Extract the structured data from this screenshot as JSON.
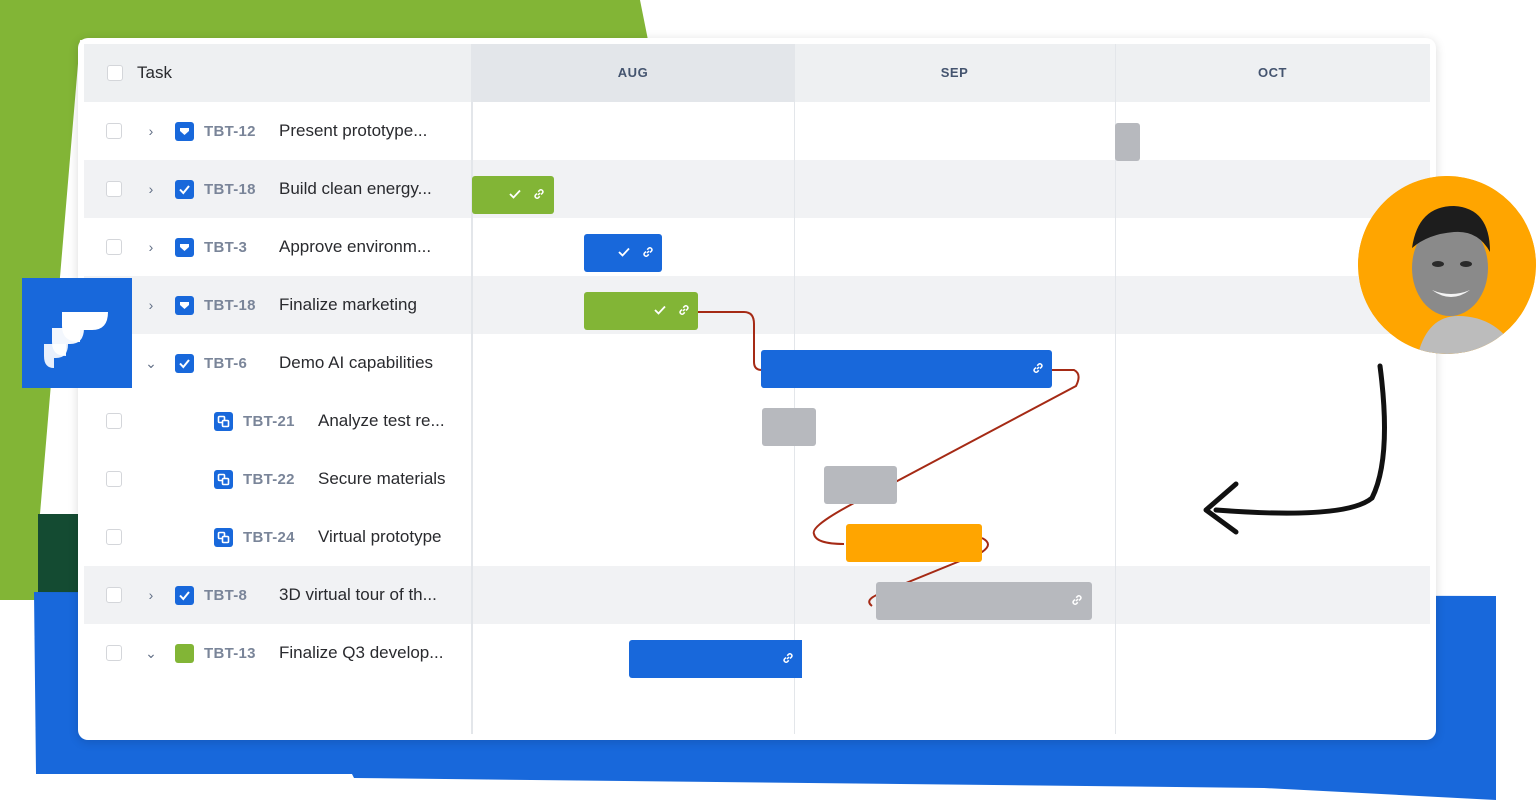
{
  "colors": {
    "blue": "#1868db",
    "green": "#82b536",
    "gray": "#b7b9be",
    "orange": "#ffa500",
    "dependency_line": "#a52a15"
  },
  "header": {
    "task_label": "Task",
    "months": [
      "AUG",
      "SEP",
      "OCT"
    ]
  },
  "rows": [
    {
      "key": "TBT-12",
      "title": "Present prototype...",
      "type": "epic",
      "expand": "collapsed"
    },
    {
      "key": "TBT-18",
      "title": "Build clean energy...",
      "type": "task",
      "expand": "collapsed"
    },
    {
      "key": "TBT-3",
      "title": "Approve environm...",
      "type": "epic",
      "expand": "collapsed"
    },
    {
      "key": "TBT-18",
      "title": "Finalize marketing",
      "type": "epic",
      "expand": "collapsed"
    },
    {
      "key": "TBT-6",
      "title": "Demo AI capabilities",
      "type": "task",
      "expand": "expanded"
    },
    {
      "key": "TBT-21",
      "title": "Analyze test re...",
      "type": "subtask",
      "expand": "none"
    },
    {
      "key": "TBT-22",
      "title": "Secure materials",
      "type": "subtask",
      "expand": "none"
    },
    {
      "key": "TBT-24",
      "title": "Virtual prototype",
      "type": "subtask",
      "expand": "none"
    },
    {
      "key": "TBT-8",
      "title": "3D virtual tour of th...",
      "type": "task",
      "expand": "collapsed"
    },
    {
      "key": "TBT-13",
      "title": "Finalize Q3 develop...",
      "type": "story",
      "expand": "expanded"
    }
  ],
  "bar_icons": {
    "check": "check-icon",
    "link": "link-icon"
  }
}
